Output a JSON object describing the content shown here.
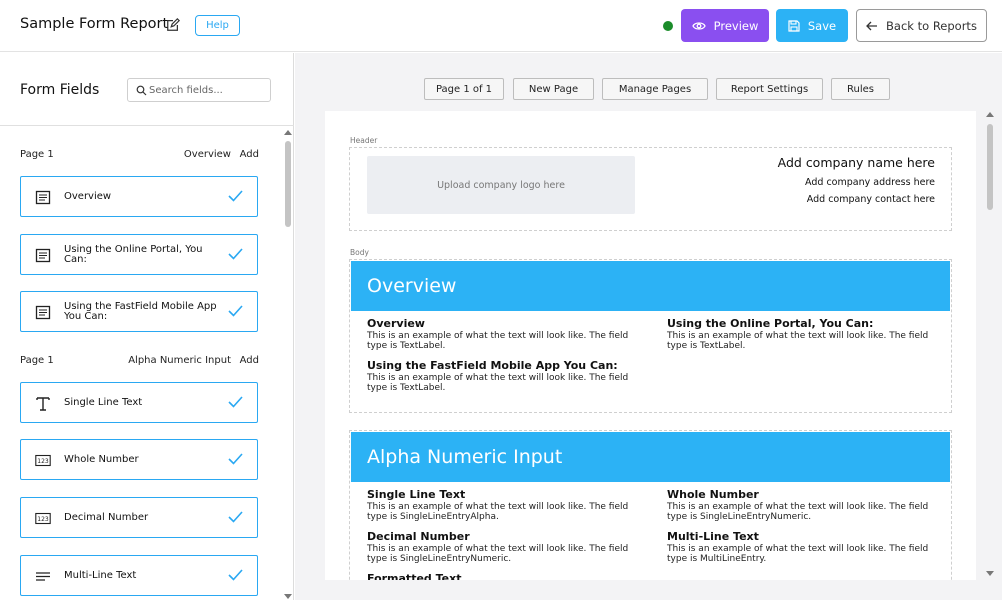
{
  "header": {
    "title": "Sample Form Report",
    "help_label": "Help",
    "preview_label": "Preview",
    "save_label": "Save",
    "back_label": "Back to Reports",
    "status_color": "#1b8c2a",
    "preview_color": "#8a4ff0",
    "save_color": "#2cb2f5"
  },
  "sidebar": {
    "title": "Form Fields",
    "search_placeholder": "Search fields...",
    "groups": [
      {
        "page": "Page 1",
        "section": "Overview",
        "add_label": "Add",
        "fields": [
          {
            "label": "Overview",
            "icon": "text-label-icon"
          },
          {
            "label": "Using the Online Portal, You Can:",
            "icon": "text-label-icon"
          },
          {
            "label": "Using the FastField Mobile App You Can:",
            "icon": "text-label-icon"
          }
        ]
      },
      {
        "page": "Page 1",
        "section": "Alpha Numeric Input",
        "add_label": "Add",
        "fields": [
          {
            "label": "Single Line Text",
            "icon": "text-t-icon"
          },
          {
            "label": "Whole Number",
            "icon": "number-123-icon"
          },
          {
            "label": "Decimal Number",
            "icon": "number-123-icon"
          },
          {
            "label": "Multi-Line Text",
            "icon": "multiline-icon"
          }
        ]
      }
    ]
  },
  "toolbar": {
    "page_indicator": "Page 1 of 1",
    "new_page": "New Page",
    "manage_pages": "Manage Pages",
    "report_settings": "Report Settings",
    "rules": "Rules"
  },
  "report": {
    "header_label": "Header",
    "body_label": "Body",
    "logo_placeholder": "Upload company logo here",
    "company_name": "Add company name here",
    "company_address": "Add company address here",
    "company_contact": "Add company contact here",
    "sections": [
      {
        "title": "Overview",
        "items": [
          {
            "title": "Overview",
            "desc": "This is an example of what the text will look like. The field type is TextLabel."
          },
          {
            "title": "Using the Online Portal, You Can:",
            "desc": "This is an example of what the text will look like. The field type is TextLabel."
          },
          {
            "title": "Using the FastField Mobile App You Can:",
            "desc": "This is an example of what the text will look like. The field type is TextLabel."
          }
        ]
      },
      {
        "title": "Alpha Numeric Input",
        "items": [
          {
            "title": "Single Line Text",
            "desc": "This is an example of what the text will look like. The field type is SingleLineEntryAlpha."
          },
          {
            "title": "Whole Number",
            "desc": "This is an example of what the text will look like. The field type is SingleLineEntryNumeric."
          },
          {
            "title": "Decimal Number",
            "desc": "This is an example of what the text will look like. The field type is SingleLineEntryNumeric."
          },
          {
            "title": "Multi-Line Text",
            "desc": "This is an example of what the text will look like. The field type is MultiLineEntry."
          },
          {
            "title": "Formatted Text",
            "desc": ""
          }
        ]
      }
    ]
  }
}
